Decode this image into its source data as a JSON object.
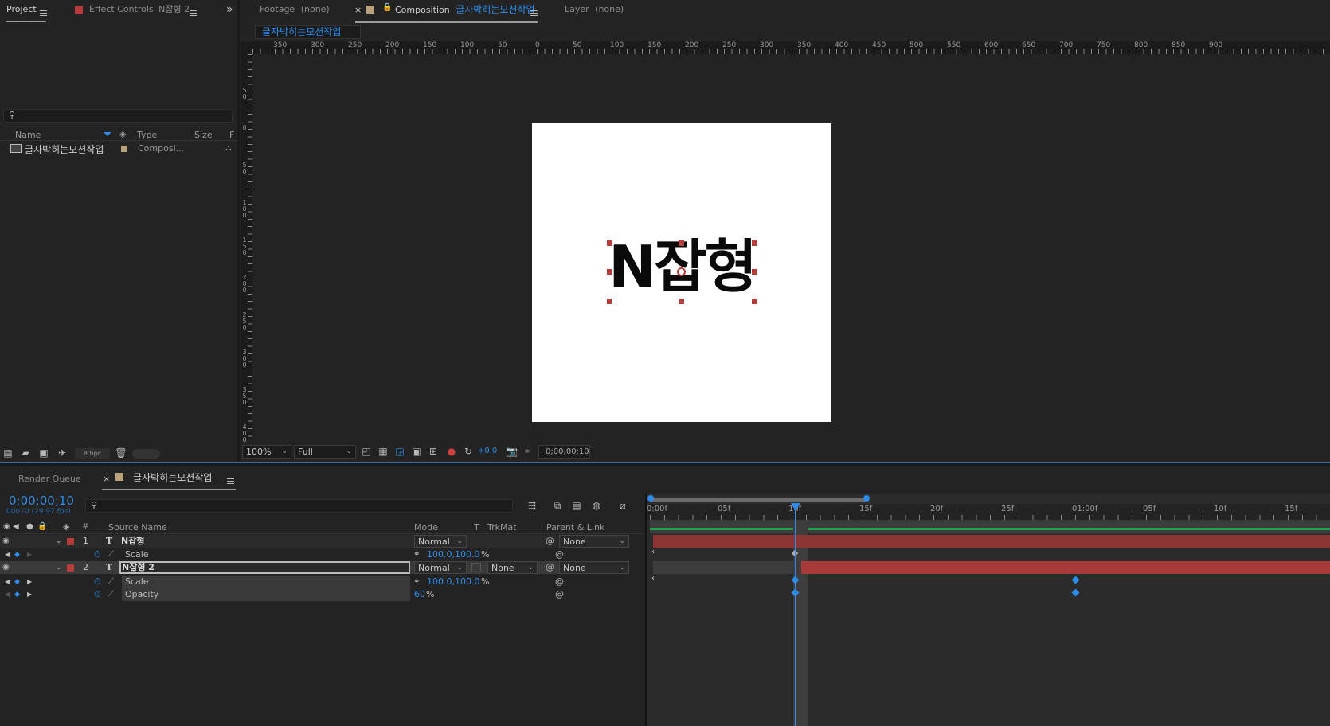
{
  "project_panel": {
    "tab_project": "Project",
    "tab_effect_controls": "Effect Controls",
    "effect_layer": "N잡형 2",
    "search_placeholder": "",
    "columns": [
      "Name",
      "Type",
      "Size",
      "F"
    ],
    "items": [
      {
        "name": "글자박히는모션작업",
        "type": "Composi..."
      }
    ],
    "bit_depth": "8 bpc"
  },
  "viewer_tabs": {
    "footage": "Footage",
    "footage_value": "(none)",
    "composition": "Composition",
    "composition_name": "글자박히는모션작업",
    "layer": "Layer",
    "layer_value": "(none)",
    "breadcrumb": "글자박히는모션작업"
  },
  "h_ruler_labels": [
    "350",
    "300",
    "250",
    "200",
    "150",
    "100",
    "50",
    "0",
    "50",
    "100",
    "150",
    "200",
    "250",
    "300",
    "350",
    "400",
    "450",
    "500",
    "550",
    "600",
    "650",
    "700",
    "750",
    "800",
    "850",
    "900"
  ],
  "v_ruler_labels": [
    "50",
    "0",
    "50",
    "100",
    "150",
    "200",
    "250",
    "300",
    "350",
    "400"
  ],
  "canvas_text": "N잡형",
  "viewer_footer": {
    "zoom": "100%",
    "resolution": "Full",
    "exposure": "+0.0",
    "timecode": "0;00;00;10"
  },
  "timeline_tabs": {
    "render_queue": "Render Queue",
    "comp": "글자박히는모션작업"
  },
  "timeline": {
    "current_time": "0;00;00;10",
    "frame_info": "00010 (29.97 fps)",
    "search_placeholder": "",
    "columns": {
      "num": "#",
      "source_name": "Source Name",
      "mode": "Mode",
      "t": "T",
      "trkmat": "TrkMat",
      "parent": "Parent & Link"
    },
    "ruler_labels": [
      "0:00f",
      "05f",
      "10f",
      "15f",
      "20f",
      "25f",
      "01:00f",
      "05f",
      "10f",
      "15f"
    ],
    "layers": [
      {
        "index": "1",
        "name": "N잡형",
        "mode": "Normal",
        "trkmat": "",
        "parent": "None",
        "properties": [
          {
            "name": "Scale",
            "value": "100.0,100.0",
            "unit": "%"
          }
        ]
      },
      {
        "index": "2",
        "name": "N잡형 2",
        "mode": "Normal",
        "trkmat": "None",
        "parent": "None",
        "properties": [
          {
            "name": "Scale",
            "value": "100.0,100.0",
            "unit": "%"
          },
          {
            "name": "Opacity",
            "value": "60",
            "unit": "%"
          }
        ]
      }
    ]
  },
  "colors": {
    "accent": "#2d8ceb",
    "layer_label": "#b73c3c",
    "bar1": "#8b3535",
    "bar2": "#a83a3a",
    "work_area": "#1fa34a"
  }
}
